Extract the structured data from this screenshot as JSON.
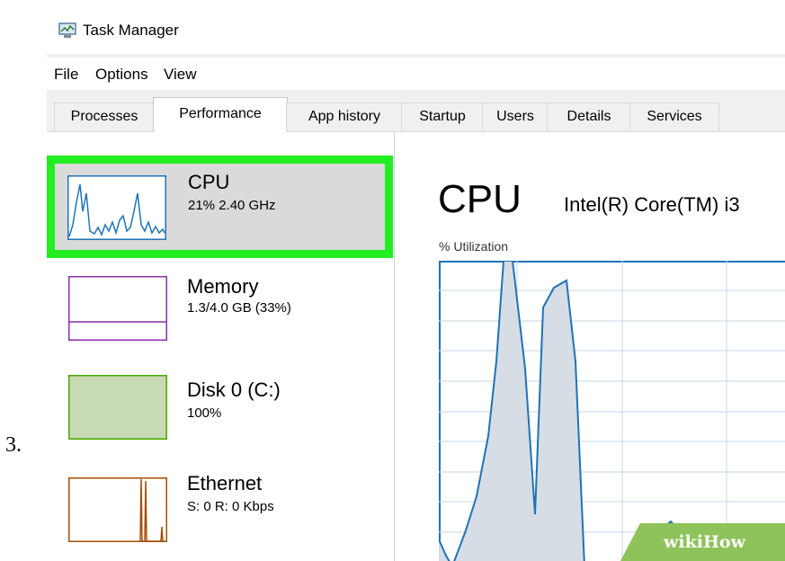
{
  "step": "3.",
  "window": {
    "title": "Task Manager"
  },
  "menu": {
    "items": [
      "File",
      "Options",
      "View"
    ]
  },
  "tabs": [
    "Processes",
    "Performance",
    "App history",
    "Startup",
    "Users",
    "Details",
    "Services"
  ],
  "active_tab": "Performance",
  "sidebar": {
    "items": [
      {
        "name": "CPU",
        "stat": "21% 2.40 GHz",
        "selected": true,
        "color": "#1f73b6"
      },
      {
        "name": "Memory",
        "stat": "1.3/4.0 GB (33%)",
        "color": "#8b2fa8"
      },
      {
        "name": "Disk 0 (C:)",
        "stat": "100%",
        "color": "#4da600"
      },
      {
        "name": "Ethernet",
        "stat": "S: 0 R: 0 Kbps",
        "color": "#a64d00"
      }
    ]
  },
  "main": {
    "title": "CPU",
    "processor": "Intel(R) Core(TM) i3",
    "utilization_label": "% Utilization"
  },
  "watermark": "wikiHow",
  "colors": {
    "highlight": "#22ee22",
    "cpu_line": "#1f73b6",
    "cpu_fill": "#d7dde4",
    "grid": "#c4d7e6"
  }
}
